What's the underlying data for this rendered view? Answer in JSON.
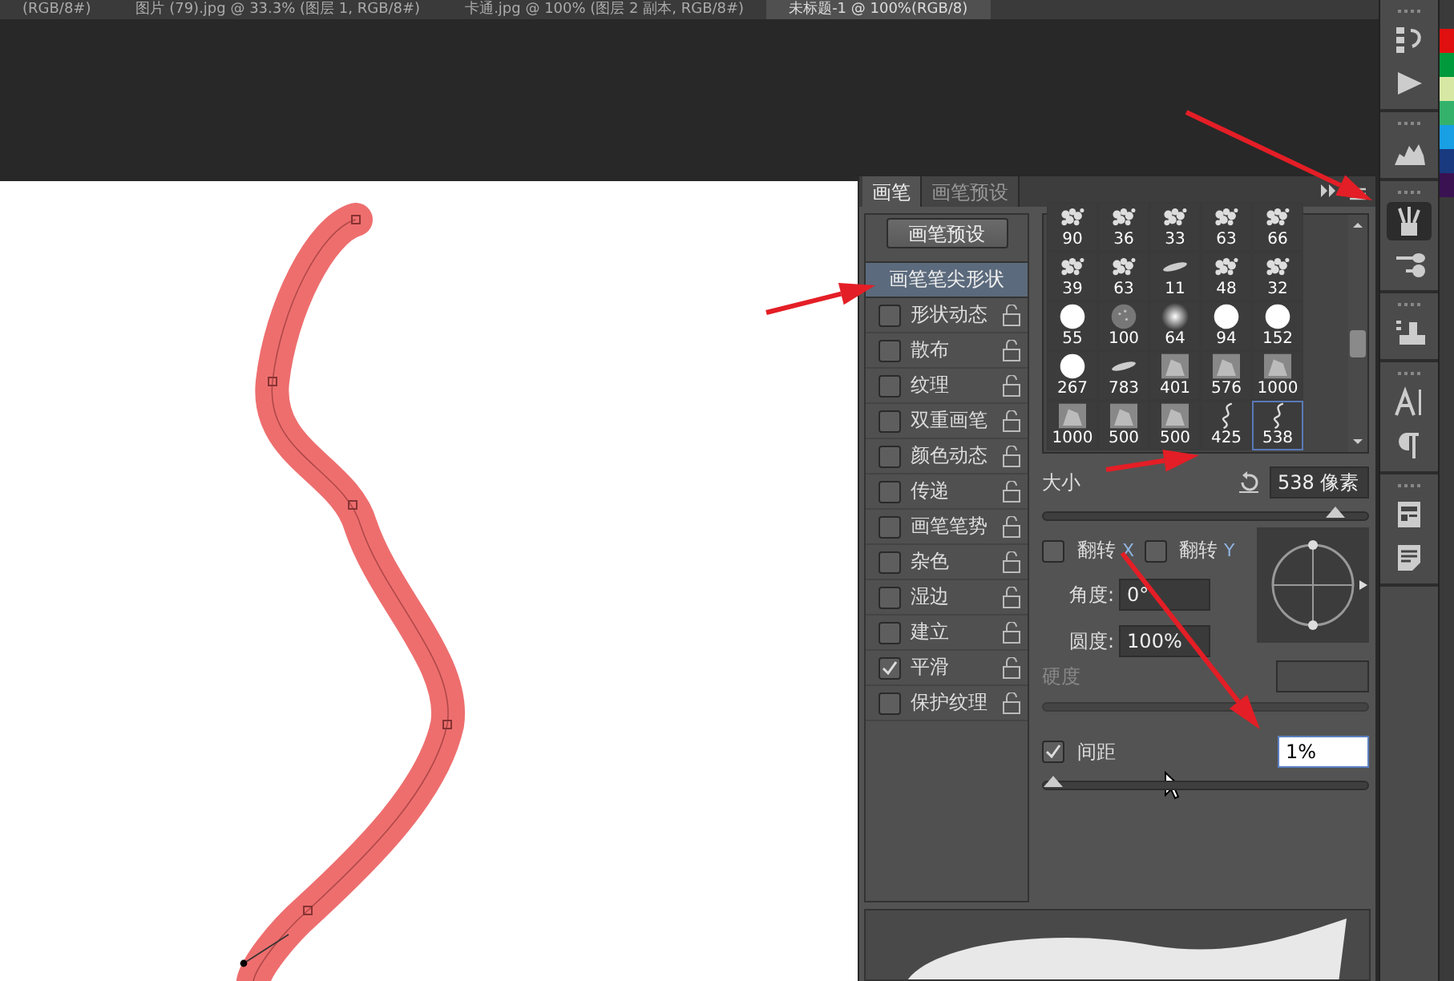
{
  "document_tabs": [
    {
      "label": "(RGB/8#)",
      "selected": false
    },
    {
      "label": "图片 (79).jpg @ 33.3% (图层 1, RGB/8#)",
      "selected": false
    },
    {
      "label": "卡通.jpg @ 100% (图层 2 副本, RGB/8#)",
      "selected": false
    },
    {
      "label": "未标题-1 @ 100%(RGB/8)",
      "selected": true
    }
  ],
  "panel": {
    "tabs": [
      {
        "label": "画笔",
        "selected": true
      },
      {
        "label": "画笔预设",
        "selected": false
      }
    ],
    "preset_button": "画笔预设",
    "options": [
      {
        "kind": "header",
        "label": "画笔笔尖形状",
        "selected": true
      },
      {
        "kind": "option",
        "label": "形状动态",
        "checked": false
      },
      {
        "kind": "option",
        "label": "散布",
        "checked": false
      },
      {
        "kind": "option",
        "label": "纹理",
        "checked": false
      },
      {
        "kind": "option",
        "label": "双重画笔",
        "checked": false
      },
      {
        "kind": "option",
        "label": "颜色动态",
        "checked": false
      },
      {
        "kind": "option",
        "label": "传递",
        "checked": false
      },
      {
        "kind": "option",
        "label": "画笔笔势",
        "checked": false
      },
      {
        "kind": "option",
        "label": "杂色",
        "checked": false
      },
      {
        "kind": "option",
        "label": "湿边",
        "checked": false
      },
      {
        "kind": "option",
        "label": "建立",
        "checked": false
      },
      {
        "kind": "option",
        "label": "平滑",
        "checked": true
      },
      {
        "kind": "option",
        "label": "保护纹理",
        "checked": false
      }
    ],
    "brushes": [
      {
        "kind": "splat",
        "size": "90",
        "selected": false
      },
      {
        "kind": "splat",
        "size": "36",
        "selected": false
      },
      {
        "kind": "splat",
        "size": "33",
        "selected": false
      },
      {
        "kind": "splat",
        "size": "63",
        "selected": false
      },
      {
        "kind": "splat",
        "size": "66",
        "selected": false
      },
      {
        "kind": "splat",
        "size": "39",
        "selected": false
      },
      {
        "kind": "splat",
        "size": "63",
        "selected": false
      },
      {
        "kind": "stroke",
        "size": "11",
        "selected": false
      },
      {
        "kind": "splat",
        "size": "48",
        "selected": false
      },
      {
        "kind": "splat",
        "size": "32",
        "selected": false
      },
      {
        "kind": "round",
        "size": "55",
        "selected": false
      },
      {
        "kind": "noise",
        "size": "100",
        "selected": false
      },
      {
        "kind": "soft",
        "size": "64",
        "selected": false
      },
      {
        "kind": "round",
        "size": "94",
        "selected": false
      },
      {
        "kind": "round",
        "size": "152",
        "selected": false
      },
      {
        "kind": "round",
        "size": "267",
        "selected": false
      },
      {
        "kind": "stroke",
        "size": "783",
        "selected": false
      },
      {
        "kind": "photo",
        "size": "401",
        "selected": false
      },
      {
        "kind": "photo",
        "size": "576",
        "selected": false
      },
      {
        "kind": "photo",
        "size": "1000",
        "selected": false
      },
      {
        "kind": "photo",
        "size": "1000",
        "selected": false
      },
      {
        "kind": "photo",
        "size": "500",
        "selected": false
      },
      {
        "kind": "photo",
        "size": "500",
        "selected": false
      },
      {
        "kind": "squiggle",
        "size": "425",
        "selected": false
      },
      {
        "kind": "squiggle",
        "size": "538",
        "selected": true
      }
    ],
    "size": {
      "label": "大小",
      "value": "538 像素",
      "level": 0.9
    },
    "flip": [
      {
        "label": "翻转",
        "axis": "X",
        "checked": false
      },
      {
        "label": "翻转",
        "axis": "Y",
        "checked": false
      }
    ],
    "angle": {
      "label": "角度:",
      "value": "0°"
    },
    "roundness": {
      "label": "圆度:",
      "value": "100%"
    },
    "hardness": {
      "label": "硬度",
      "disabled": true
    },
    "spacing": {
      "label": "间距",
      "checked": true,
      "value": "1%",
      "level": 0
    }
  },
  "dock": [
    {
      "kind": "history",
      "selected": false
    },
    {
      "kind": "play",
      "selected": false
    },
    {
      "kind": "histogram",
      "selected": false
    },
    {
      "kind": "brushes",
      "selected": true
    },
    {
      "kind": "brush-presets",
      "selected": false
    },
    {
      "kind": "stamp",
      "selected": false
    },
    {
      "kind": "character",
      "selected": false
    },
    {
      "kind": "paragraph",
      "selected": false
    },
    {
      "kind": "notes",
      "selected": false
    },
    {
      "kind": "document",
      "selected": false
    }
  ],
  "swatches": [
    {
      "color": "#e01010"
    },
    {
      "color": "#009a3c"
    },
    {
      "color": "#d6e8a4"
    },
    {
      "color": "#34b26c"
    },
    {
      "color": "#189fe4"
    },
    {
      "color": "#1a3a80"
    },
    {
      "color": "#3a1252"
    }
  ]
}
